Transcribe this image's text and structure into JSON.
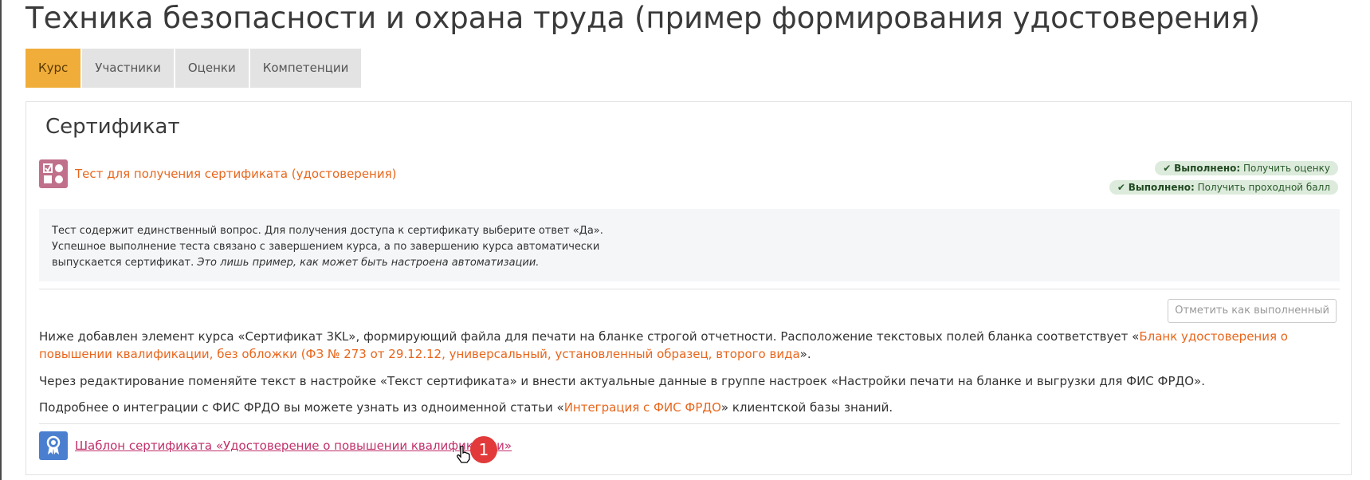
{
  "page_title": "Техника безопасности и охрана труда (пример формирования удостоверения)",
  "tabs": [
    {
      "label": "Курс",
      "active": true
    },
    {
      "label": "Участники",
      "active": false
    },
    {
      "label": "Оценки",
      "active": false
    },
    {
      "label": "Компетенции",
      "active": false
    }
  ],
  "section": {
    "title": "Сертификат",
    "activity": {
      "icon": "quiz-icon",
      "link_text": "Тест для получения сертификата (удостоверения)"
    },
    "completion_badges": [
      {
        "status": "Выполнено:",
        "text": "Получить оценку"
      },
      {
        "status": "Выполнено:",
        "text": "Получить проходной балл"
      }
    ],
    "description": {
      "line1": "Тест содержит единственный вопрос. Для получения доступа к сертификату выберите ответ «Да».",
      "line2": "Успешное выполнение теста связано с завершением курса, а по завершению курса автоматически",
      "line3_plain": "выпускается сертификат. ",
      "line3_italic": "Это лишь пример, как может быть настроена автоматизации."
    },
    "mark_done_button": "Отметить как выполненный",
    "paragraph1": {
      "before": "Ниже добавлен элемент курса «Сертификат 3KL», формирующий файла для печати на бланке строгой отчетности. Расположение текстовых полей бланка соответствует  «",
      "link": "Бланк удостоверения о повышении квалификации, без обложки (ФЗ № 273 от 29.12.12, универсальный, установленный образец, второго вида",
      "after": "»."
    },
    "paragraph2": "Через редактирование поменяйте текст в настройке «Текст сертификата» и внести актуальные данные в группе настроек «Настройки печати на бланке и выгрузки для ФИС ФРДО».",
    "paragraph3": {
      "before": "Подробнее о интеграции с ФИС ФРДО вы можете узнать из одноименной статьи «",
      "link": "Интеграция с ФИС ФРДО",
      "after": "» клиентской базы знаний."
    },
    "certificate": {
      "icon": "certificate-icon",
      "link_text": "Шаблон сертификата «Удостоверение о повышении квалификации»"
    }
  },
  "step_marker": "1",
  "colors": {
    "accent_tab": "#f0ad3a",
    "link_orange": "#e8661c",
    "link_pink": "#c0306a",
    "badge_bg": "#dcebdc",
    "step_red": "#e23a3a"
  }
}
